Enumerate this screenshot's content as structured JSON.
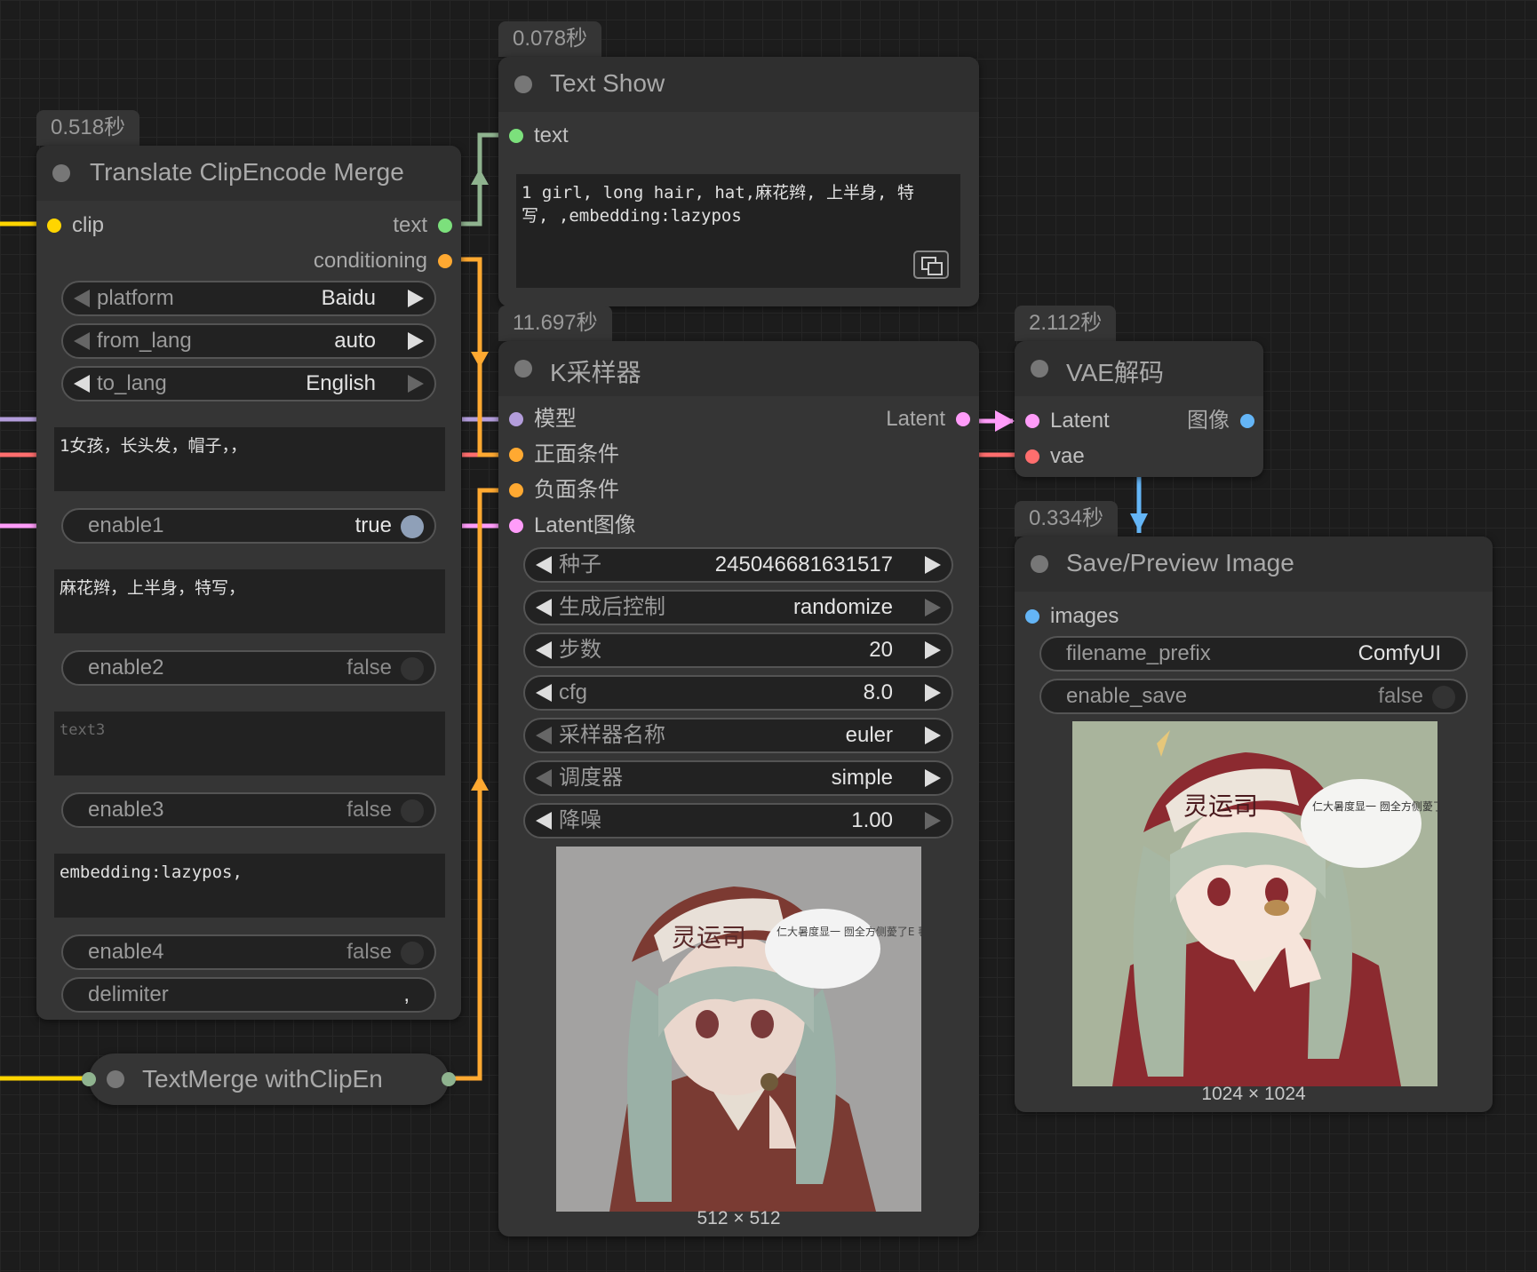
{
  "nodes": {
    "translate": {
      "time": "0.518秒",
      "title": "Translate ClipEncode Merge",
      "inputs": {
        "clip": "clip"
      },
      "outputs": {
        "text": "text",
        "conditioning": "conditioning"
      },
      "platform": {
        "label": "platform",
        "value": "Baidu"
      },
      "from_lang": {
        "label": "from_lang",
        "value": "auto"
      },
      "to_lang": {
        "label": "to_lang",
        "value": "English"
      },
      "text1": "1女孩，长头发，帽子，，",
      "enable1": {
        "label": "enable1",
        "value": "true"
      },
      "text2": "麻花辫，上半身，特写，",
      "enable2": {
        "label": "enable2",
        "value": "false"
      },
      "text3_placeholder": "text3",
      "enable3": {
        "label": "enable3",
        "value": "false"
      },
      "text4": "embedding:lazypos,",
      "enable4": {
        "label": "enable4",
        "value": "false"
      },
      "delimiter": {
        "label": "delimiter",
        "value": ","
      }
    },
    "textmerge": {
      "title": "TextMerge withClipEn"
    },
    "textshow": {
      "time": "0.078秒",
      "title": "Text Show",
      "inputs": {
        "text": "text"
      },
      "content": "1 girl, long hair, hat,麻花辫, 上半身, 特\n写, ,embedding:lazypos"
    },
    "ksampler": {
      "time": "11.697秒",
      "title": "K采样器",
      "inputs": {
        "model": "模型",
        "positive": "正面条件",
        "negative": "负面条件",
        "latent": "Latent图像"
      },
      "outputs": {
        "latent": "Latent"
      },
      "seed": {
        "label": "种子",
        "value": "245046681631517"
      },
      "control": {
        "label": "生成后控制",
        "value": "randomize"
      },
      "steps": {
        "label": "步数",
        "value": "20"
      },
      "cfg": {
        "label": "cfg",
        "value": "8.0"
      },
      "sampler": {
        "label": "采样器名称",
        "value": "euler"
      },
      "scheduler": {
        "label": "调度器",
        "value": "simple"
      },
      "denoise": {
        "label": "降噪",
        "value": "1.00"
      },
      "image_caption": "512 × 512"
    },
    "vae": {
      "time": "2.112秒",
      "title": "VAE解码",
      "inputs": {
        "latent": "Latent",
        "vae": "vae"
      },
      "outputs": {
        "image": "图像"
      }
    },
    "save": {
      "time": "0.334秒",
      "title": "Save/Preview Image",
      "inputs": {
        "images": "images"
      },
      "filename_prefix": {
        "label": "filename_prefix",
        "value": "ComfyUI"
      },
      "enable_save": {
        "label": "enable_save",
        "value": "false"
      },
      "image_caption": "1024 × 1024"
    }
  },
  "colors": {
    "clip": "#ffd500",
    "conditioning": "#ffa931",
    "model": "#b39ddb",
    "latent": "#ff9cf9",
    "vae": "#ff6e6e",
    "image": "#64b5f6",
    "text": "#7ce07c",
    "string_link": "#8fb38f"
  },
  "preview_image_content": {
    "hat_text": "灵运司",
    "speech_bubble": "仁大暑度显一 囫全方侧薆了E 毬晷て薆全诸撮乂 元泚妆吾;"
  }
}
